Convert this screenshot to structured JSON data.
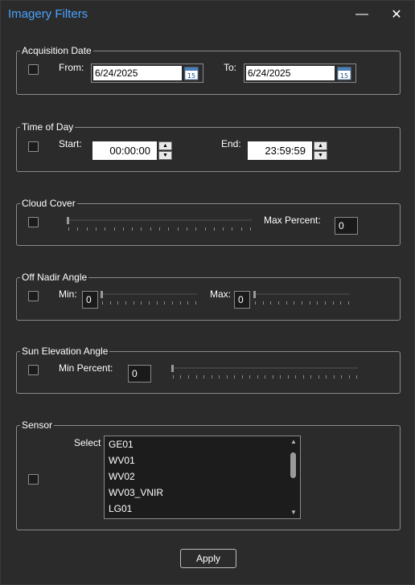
{
  "window": {
    "title": "Imagery Filters",
    "minimize_icon": "minimize-icon",
    "close_icon": "close-icon"
  },
  "acquisition_date": {
    "legend": "Acquisition Date",
    "from_label": "From:",
    "from_value": "6/24/2025",
    "to_label": "To:",
    "to_value": "6/24/2025",
    "calendar_day": "15"
  },
  "time_of_day": {
    "legend": "Time of Day",
    "start_label": "Start:",
    "start_value": "00:00:00",
    "end_label": "End:",
    "end_value": "23:59:59"
  },
  "cloud_cover": {
    "legend": "Cloud Cover",
    "max_label": "Max Percent:",
    "max_value": "0",
    "slider_level": 0
  },
  "off_nadir": {
    "legend": "Off Nadir Angle",
    "min_label": "Min:",
    "min_value": "0",
    "max_label": "Max:",
    "max_value": "0",
    "min_slider_level": 0,
    "max_slider_level": 0
  },
  "sun_elevation": {
    "legend": "Sun Elevation Angle",
    "min_label": "Min Percent:",
    "min_value": "0",
    "slider_level": 0
  },
  "sensor": {
    "legend": "Sensor",
    "select_label": "Select",
    "items": [
      "GE01",
      "WV01",
      "WV02",
      "WV03_VNIR",
      "LG01"
    ]
  },
  "actions": {
    "apply_label": "Apply"
  },
  "colors": {
    "title": "#4aa3ff",
    "background": "#2b2b2b",
    "border": "#8a8a8a"
  }
}
